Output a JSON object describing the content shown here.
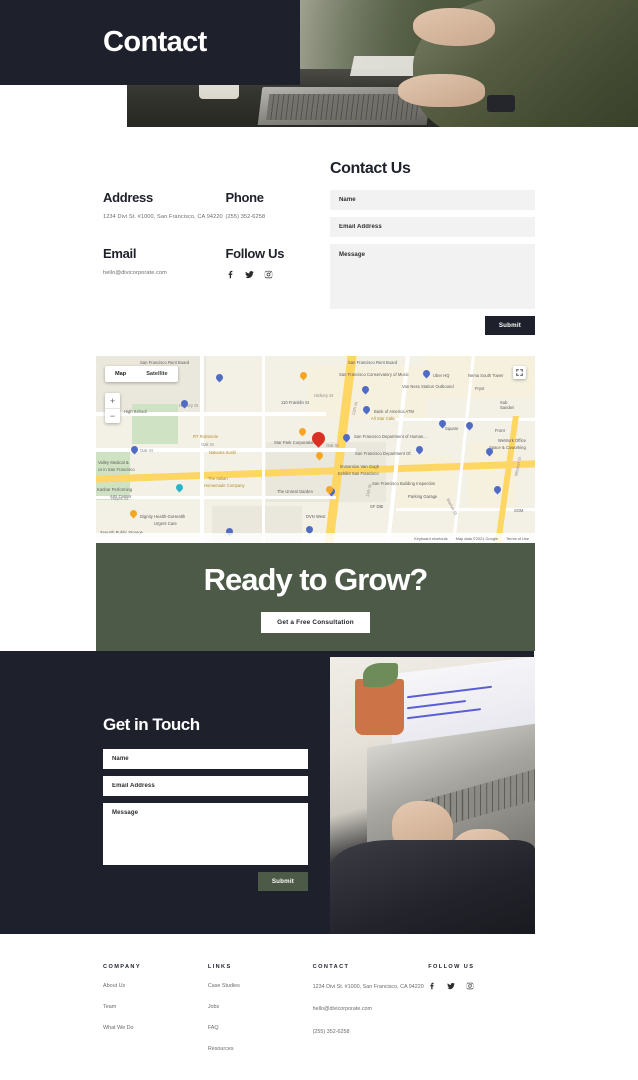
{
  "colors": {
    "dark": "#1e212b",
    "green": "#4c5a47",
    "field_bg": "#f2f2f2",
    "muted_text": "#6b6b6b",
    "white": "#ffffff"
  },
  "hero": {
    "title": "Contact",
    "photo_alt": "person-at-desk-with-laptop"
  },
  "contact_info": {
    "address_label": "Address",
    "address_value": "1234 Divi St. #1000, San Francisco, CA 94220",
    "phone_label": "Phone",
    "phone_value": "(255) 352-6258",
    "email_label": "Email",
    "email_value": "hello@divicorporate.com",
    "follow_label": "Follow Us",
    "socials": [
      "facebook-icon",
      "twitter-icon",
      "instagram-icon"
    ]
  },
  "contact_form": {
    "title": "Contact Us",
    "name_placeholder": "Name",
    "email_placeholder": "Email Address",
    "message_placeholder": "Message",
    "submit_label": "Submit"
  },
  "map": {
    "type_map": "Map",
    "type_satellite": "Satellite",
    "zoom_in": "+",
    "zoom_out": "−",
    "fullscreen_icon": "expand-icon",
    "keyboard_shortcuts": "Keyboard shortcuts",
    "attribution": "Map data ©2021 Google",
    "terms": "Terms of Use",
    "labels": [
      "San Francisco Rent Board",
      "San Francisco Conservatory of Music",
      "Van Ness Station Outbound",
      "Uber HQ",
      "Nema South Tower",
      "Bank of America ATM",
      "Front",
      "Square",
      "WeWork Office Space & Coworking",
      "San Francisco Department of Human...",
      "San Francisco Department Of.",
      "San Francisco Building Inspection",
      "Parking Garage",
      "SF DBI",
      "Star Park Corporation",
      "All Star Cafe",
      "110 Franklin St",
      "RT Rotisserie",
      "Nakama Sushi",
      "The Italian Homemade Company",
      "The Unreal Garden",
      "Valley Medical & cs in San Francisco",
      "Kanbar Performing Arts Center",
      "Dignity Health-GoHealth Urgent Care",
      "Zenurth Public Storage",
      "DVN West",
      "Immersive Van Gogh Exhibit San Francisco",
      "Hickory St",
      "Oak St",
      "Hayes St",
      "Market St",
      "Mission St",
      "High School",
      "12th St",
      "11th St"
    ]
  },
  "cta": {
    "heading": "Ready to Grow?",
    "button_label": "Get a Free Consultation"
  },
  "get_in_touch": {
    "title": "Get in Touch",
    "name_placeholder": "Name",
    "email_placeholder": "Email Address",
    "message_placeholder": "Message",
    "submit_label": "Submit",
    "photo_alt": "hands-typing-on-laptop"
  },
  "footer": {
    "company": {
      "heading": "COMPANY",
      "links": [
        "About Us",
        "Team",
        "What We Do"
      ]
    },
    "links": {
      "heading": "LINKS",
      "links": [
        "Case Studies",
        "Jobs",
        "FAQ",
        "Resources"
      ]
    },
    "contact": {
      "heading": "CONTACT",
      "address": "1234 Divi St. #1000, San Francisco, CA 94220",
      "email": "hello@divicorporate.com",
      "phone": "(255) 352-6258"
    },
    "follow": {
      "heading": "FOLLOW US",
      "socials": [
        "facebook-icon",
        "twitter-icon",
        "instagram-icon"
      ]
    }
  }
}
